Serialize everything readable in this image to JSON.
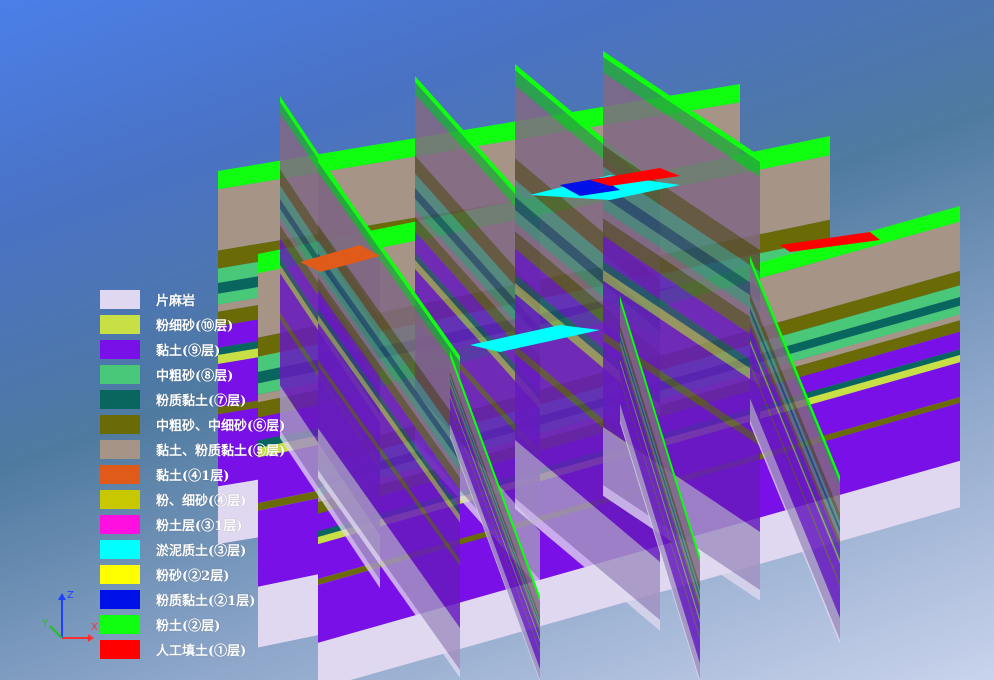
{
  "legend": {
    "items": [
      {
        "label": "片麻岩",
        "color": "#e0d8f0"
      },
      {
        "label": "粉细砂(⑩层)",
        "color": "#c8e046"
      },
      {
        "label": "黏土(⑨层)",
        "color": "#7a10e8"
      },
      {
        "label": "中粗砂(⑧层)",
        "color": "#48c878"
      },
      {
        "label": "粉质黏土(⑦层)",
        "color": "#08665e"
      },
      {
        "label": "中粗砂、中细砂(⑥层)",
        "color": "#6a6a06"
      },
      {
        "label": "黏土、粉质黏土(⑤层)",
        "color": "#a69486"
      },
      {
        "label": "黏土(④1层)",
        "color": "#e05a1a"
      },
      {
        "label": "粉、细砂(④层)",
        "color": "#c8c800"
      },
      {
        "label": "粉土层(③1层)",
        "color": "#ff10e0"
      },
      {
        "label": "淤泥质土(③层)",
        "color": "#00ffff"
      },
      {
        "label": "粉砂(②2层)",
        "color": "#ffff00"
      },
      {
        "label": "粉质黏土(②1层)",
        "color": "#0010e8"
      },
      {
        "label": "粉土(②层)",
        "color": "#10ff10"
      },
      {
        "label": "人工填土(①层)",
        "color": "#ff0000"
      }
    ]
  },
  "axes": {
    "x_label": "X",
    "y_label": "Y",
    "z_label": "Z",
    "x_color": "#ff3030",
    "y_color": "#20c020",
    "z_color": "#2040ff",
    "icon": "axis-triad-icon"
  },
  "scene": {
    "icon": "geological-fence-diagram",
    "side_shading": "#4a2a80"
  }
}
